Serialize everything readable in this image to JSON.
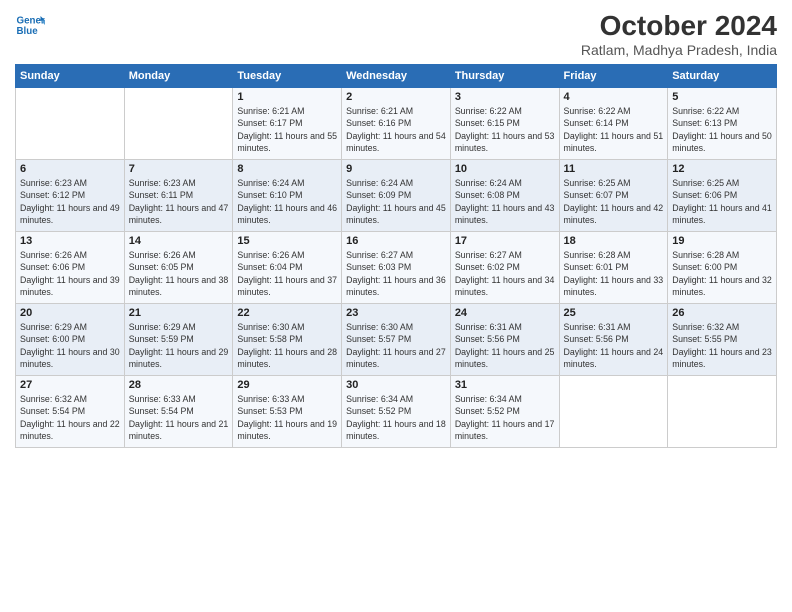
{
  "logo": {
    "line1": "General",
    "line2": "Blue"
  },
  "title": "October 2024",
  "subtitle": "Ratlam, Madhya Pradesh, India",
  "days_of_week": [
    "Sunday",
    "Monday",
    "Tuesday",
    "Wednesday",
    "Thursday",
    "Friday",
    "Saturday"
  ],
  "weeks": [
    [
      {
        "day": "",
        "sunrise": "",
        "sunset": "",
        "daylight": ""
      },
      {
        "day": "",
        "sunrise": "",
        "sunset": "",
        "daylight": ""
      },
      {
        "day": "1",
        "sunrise": "Sunrise: 6:21 AM",
        "sunset": "Sunset: 6:17 PM",
        "daylight": "Daylight: 11 hours and 55 minutes."
      },
      {
        "day": "2",
        "sunrise": "Sunrise: 6:21 AM",
        "sunset": "Sunset: 6:16 PM",
        "daylight": "Daylight: 11 hours and 54 minutes."
      },
      {
        "day": "3",
        "sunrise": "Sunrise: 6:22 AM",
        "sunset": "Sunset: 6:15 PM",
        "daylight": "Daylight: 11 hours and 53 minutes."
      },
      {
        "day": "4",
        "sunrise": "Sunrise: 6:22 AM",
        "sunset": "Sunset: 6:14 PM",
        "daylight": "Daylight: 11 hours and 51 minutes."
      },
      {
        "day": "5",
        "sunrise": "Sunrise: 6:22 AM",
        "sunset": "Sunset: 6:13 PM",
        "daylight": "Daylight: 11 hours and 50 minutes."
      }
    ],
    [
      {
        "day": "6",
        "sunrise": "Sunrise: 6:23 AM",
        "sunset": "Sunset: 6:12 PM",
        "daylight": "Daylight: 11 hours and 49 minutes."
      },
      {
        "day": "7",
        "sunrise": "Sunrise: 6:23 AM",
        "sunset": "Sunset: 6:11 PM",
        "daylight": "Daylight: 11 hours and 47 minutes."
      },
      {
        "day": "8",
        "sunrise": "Sunrise: 6:24 AM",
        "sunset": "Sunset: 6:10 PM",
        "daylight": "Daylight: 11 hours and 46 minutes."
      },
      {
        "day": "9",
        "sunrise": "Sunrise: 6:24 AM",
        "sunset": "Sunset: 6:09 PM",
        "daylight": "Daylight: 11 hours and 45 minutes."
      },
      {
        "day": "10",
        "sunrise": "Sunrise: 6:24 AM",
        "sunset": "Sunset: 6:08 PM",
        "daylight": "Daylight: 11 hours and 43 minutes."
      },
      {
        "day": "11",
        "sunrise": "Sunrise: 6:25 AM",
        "sunset": "Sunset: 6:07 PM",
        "daylight": "Daylight: 11 hours and 42 minutes."
      },
      {
        "day": "12",
        "sunrise": "Sunrise: 6:25 AM",
        "sunset": "Sunset: 6:06 PM",
        "daylight": "Daylight: 11 hours and 41 minutes."
      }
    ],
    [
      {
        "day": "13",
        "sunrise": "Sunrise: 6:26 AM",
        "sunset": "Sunset: 6:06 PM",
        "daylight": "Daylight: 11 hours and 39 minutes."
      },
      {
        "day": "14",
        "sunrise": "Sunrise: 6:26 AM",
        "sunset": "Sunset: 6:05 PM",
        "daylight": "Daylight: 11 hours and 38 minutes."
      },
      {
        "day": "15",
        "sunrise": "Sunrise: 6:26 AM",
        "sunset": "Sunset: 6:04 PM",
        "daylight": "Daylight: 11 hours and 37 minutes."
      },
      {
        "day": "16",
        "sunrise": "Sunrise: 6:27 AM",
        "sunset": "Sunset: 6:03 PM",
        "daylight": "Daylight: 11 hours and 36 minutes."
      },
      {
        "day": "17",
        "sunrise": "Sunrise: 6:27 AM",
        "sunset": "Sunset: 6:02 PM",
        "daylight": "Daylight: 11 hours and 34 minutes."
      },
      {
        "day": "18",
        "sunrise": "Sunrise: 6:28 AM",
        "sunset": "Sunset: 6:01 PM",
        "daylight": "Daylight: 11 hours and 33 minutes."
      },
      {
        "day": "19",
        "sunrise": "Sunrise: 6:28 AM",
        "sunset": "Sunset: 6:00 PM",
        "daylight": "Daylight: 11 hours and 32 minutes."
      }
    ],
    [
      {
        "day": "20",
        "sunrise": "Sunrise: 6:29 AM",
        "sunset": "Sunset: 6:00 PM",
        "daylight": "Daylight: 11 hours and 30 minutes."
      },
      {
        "day": "21",
        "sunrise": "Sunrise: 6:29 AM",
        "sunset": "Sunset: 5:59 PM",
        "daylight": "Daylight: 11 hours and 29 minutes."
      },
      {
        "day": "22",
        "sunrise": "Sunrise: 6:30 AM",
        "sunset": "Sunset: 5:58 PM",
        "daylight": "Daylight: 11 hours and 28 minutes."
      },
      {
        "day": "23",
        "sunrise": "Sunrise: 6:30 AM",
        "sunset": "Sunset: 5:57 PM",
        "daylight": "Daylight: 11 hours and 27 minutes."
      },
      {
        "day": "24",
        "sunrise": "Sunrise: 6:31 AM",
        "sunset": "Sunset: 5:56 PM",
        "daylight": "Daylight: 11 hours and 25 minutes."
      },
      {
        "day": "25",
        "sunrise": "Sunrise: 6:31 AM",
        "sunset": "Sunset: 5:56 PM",
        "daylight": "Daylight: 11 hours and 24 minutes."
      },
      {
        "day": "26",
        "sunrise": "Sunrise: 6:32 AM",
        "sunset": "Sunset: 5:55 PM",
        "daylight": "Daylight: 11 hours and 23 minutes."
      }
    ],
    [
      {
        "day": "27",
        "sunrise": "Sunrise: 6:32 AM",
        "sunset": "Sunset: 5:54 PM",
        "daylight": "Daylight: 11 hours and 22 minutes."
      },
      {
        "day": "28",
        "sunrise": "Sunrise: 6:33 AM",
        "sunset": "Sunset: 5:54 PM",
        "daylight": "Daylight: 11 hours and 21 minutes."
      },
      {
        "day": "29",
        "sunrise": "Sunrise: 6:33 AM",
        "sunset": "Sunset: 5:53 PM",
        "daylight": "Daylight: 11 hours and 19 minutes."
      },
      {
        "day": "30",
        "sunrise": "Sunrise: 6:34 AM",
        "sunset": "Sunset: 5:52 PM",
        "daylight": "Daylight: 11 hours and 18 minutes."
      },
      {
        "day": "31",
        "sunrise": "Sunrise: 6:34 AM",
        "sunset": "Sunset: 5:52 PM",
        "daylight": "Daylight: 11 hours and 17 minutes."
      },
      {
        "day": "",
        "sunrise": "",
        "sunset": "",
        "daylight": ""
      },
      {
        "day": "",
        "sunrise": "",
        "sunset": "",
        "daylight": ""
      }
    ]
  ]
}
